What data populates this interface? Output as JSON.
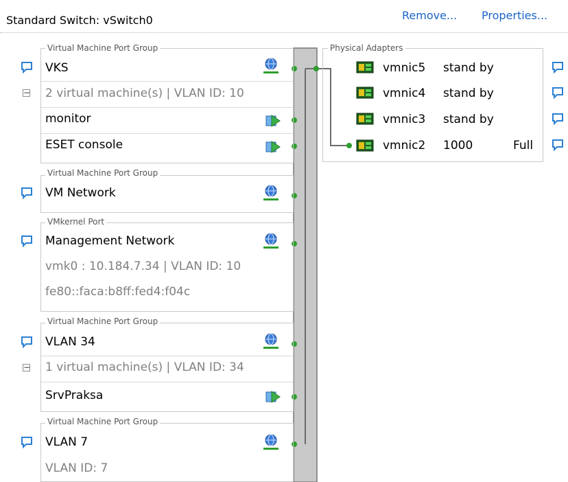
{
  "header": {
    "title": "Standard Switch: vSwitch0",
    "remove_label": "Remove...",
    "properties_label": "Properties..."
  },
  "port_groups": [
    {
      "type_label": "Virtual Machine Port Group",
      "name": "VKS",
      "summary": "2 virtual machine(s) | VLAN ID: 10",
      "vms": [
        "monitor",
        "ESET console"
      ]
    },
    {
      "type_label": "Virtual Machine Port Group",
      "name": "VM Network"
    },
    {
      "type_label": "VMkernel Port",
      "name": "Management Network",
      "lines": [
        "vmk0 : 10.184.7.34 | VLAN ID: 10",
        "fe80::faca:b8ff:fed4:f04c"
      ]
    },
    {
      "type_label": "Virtual Machine Port Group",
      "name": "VLAN 34",
      "summary": "1 virtual machine(s) | VLAN ID: 34",
      "vms": [
        "SrvPraksa"
      ]
    },
    {
      "type_label": "Virtual Machine Port Group",
      "name": "VLAN 7",
      "lines": [
        "VLAN ID: 7"
      ]
    }
  ],
  "physical": {
    "label": "Physical Adapters",
    "adapters": [
      {
        "name": "vmnic5",
        "speed": "stand by",
        "duplex": ""
      },
      {
        "name": "vmnic4",
        "speed": "stand by",
        "duplex": ""
      },
      {
        "name": "vmnic3",
        "speed": "stand by",
        "duplex": ""
      },
      {
        "name": "vmnic2",
        "speed": "1000",
        "duplex": "Full"
      }
    ]
  },
  "icons": {
    "comment": "speech-bubble-icon",
    "collapse": "collapse-minus-icon",
    "network": "network-globe-icon",
    "vm": "virtual-machine-icon",
    "nic": "network-adapter-card-icon"
  },
  "colors": {
    "link": "#1a64c9",
    "connector": "#2e9e2e",
    "switch_fill": "#c8c8c8",
    "line": "#6b6b6b"
  }
}
